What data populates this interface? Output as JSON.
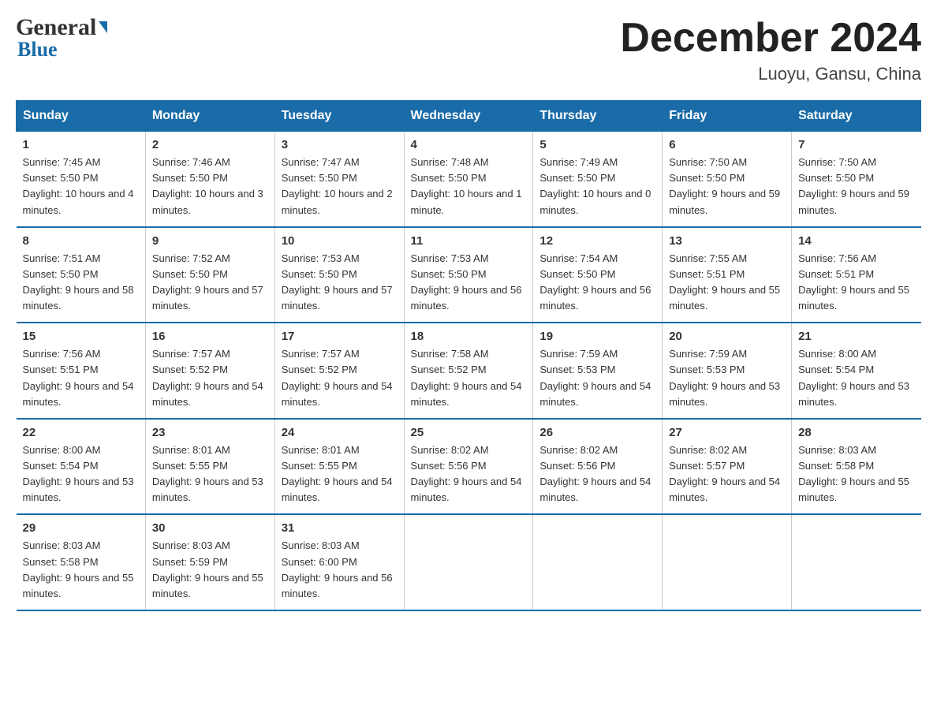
{
  "header": {
    "logo_general": "General",
    "logo_blue": "Blue",
    "month_year": "December 2024",
    "location": "Luoyu, Gansu, China"
  },
  "days_of_week": [
    "Sunday",
    "Monday",
    "Tuesday",
    "Wednesday",
    "Thursday",
    "Friday",
    "Saturday"
  ],
  "weeks": [
    [
      {
        "day": "1",
        "sunrise": "7:45 AM",
        "sunset": "5:50 PM",
        "daylight": "10 hours and 4 minutes."
      },
      {
        "day": "2",
        "sunrise": "7:46 AM",
        "sunset": "5:50 PM",
        "daylight": "10 hours and 3 minutes."
      },
      {
        "day": "3",
        "sunrise": "7:47 AM",
        "sunset": "5:50 PM",
        "daylight": "10 hours and 2 minutes."
      },
      {
        "day": "4",
        "sunrise": "7:48 AM",
        "sunset": "5:50 PM",
        "daylight": "10 hours and 1 minute."
      },
      {
        "day": "5",
        "sunrise": "7:49 AM",
        "sunset": "5:50 PM",
        "daylight": "10 hours and 0 minutes."
      },
      {
        "day": "6",
        "sunrise": "7:50 AM",
        "sunset": "5:50 PM",
        "daylight": "9 hours and 59 minutes."
      },
      {
        "day": "7",
        "sunrise": "7:50 AM",
        "sunset": "5:50 PM",
        "daylight": "9 hours and 59 minutes."
      }
    ],
    [
      {
        "day": "8",
        "sunrise": "7:51 AM",
        "sunset": "5:50 PM",
        "daylight": "9 hours and 58 minutes."
      },
      {
        "day": "9",
        "sunrise": "7:52 AM",
        "sunset": "5:50 PM",
        "daylight": "9 hours and 57 minutes."
      },
      {
        "day": "10",
        "sunrise": "7:53 AM",
        "sunset": "5:50 PM",
        "daylight": "9 hours and 57 minutes."
      },
      {
        "day": "11",
        "sunrise": "7:53 AM",
        "sunset": "5:50 PM",
        "daylight": "9 hours and 56 minutes."
      },
      {
        "day": "12",
        "sunrise": "7:54 AM",
        "sunset": "5:50 PM",
        "daylight": "9 hours and 56 minutes."
      },
      {
        "day": "13",
        "sunrise": "7:55 AM",
        "sunset": "5:51 PM",
        "daylight": "9 hours and 55 minutes."
      },
      {
        "day": "14",
        "sunrise": "7:56 AM",
        "sunset": "5:51 PM",
        "daylight": "9 hours and 55 minutes."
      }
    ],
    [
      {
        "day": "15",
        "sunrise": "7:56 AM",
        "sunset": "5:51 PM",
        "daylight": "9 hours and 54 minutes."
      },
      {
        "day": "16",
        "sunrise": "7:57 AM",
        "sunset": "5:52 PM",
        "daylight": "9 hours and 54 minutes."
      },
      {
        "day": "17",
        "sunrise": "7:57 AM",
        "sunset": "5:52 PM",
        "daylight": "9 hours and 54 minutes."
      },
      {
        "day": "18",
        "sunrise": "7:58 AM",
        "sunset": "5:52 PM",
        "daylight": "9 hours and 54 minutes."
      },
      {
        "day": "19",
        "sunrise": "7:59 AM",
        "sunset": "5:53 PM",
        "daylight": "9 hours and 54 minutes."
      },
      {
        "day": "20",
        "sunrise": "7:59 AM",
        "sunset": "5:53 PM",
        "daylight": "9 hours and 53 minutes."
      },
      {
        "day": "21",
        "sunrise": "8:00 AM",
        "sunset": "5:54 PM",
        "daylight": "9 hours and 53 minutes."
      }
    ],
    [
      {
        "day": "22",
        "sunrise": "8:00 AM",
        "sunset": "5:54 PM",
        "daylight": "9 hours and 53 minutes."
      },
      {
        "day": "23",
        "sunrise": "8:01 AM",
        "sunset": "5:55 PM",
        "daylight": "9 hours and 53 minutes."
      },
      {
        "day": "24",
        "sunrise": "8:01 AM",
        "sunset": "5:55 PM",
        "daylight": "9 hours and 54 minutes."
      },
      {
        "day": "25",
        "sunrise": "8:02 AM",
        "sunset": "5:56 PM",
        "daylight": "9 hours and 54 minutes."
      },
      {
        "day": "26",
        "sunrise": "8:02 AM",
        "sunset": "5:56 PM",
        "daylight": "9 hours and 54 minutes."
      },
      {
        "day": "27",
        "sunrise": "8:02 AM",
        "sunset": "5:57 PM",
        "daylight": "9 hours and 54 minutes."
      },
      {
        "day": "28",
        "sunrise": "8:03 AM",
        "sunset": "5:58 PM",
        "daylight": "9 hours and 55 minutes."
      }
    ],
    [
      {
        "day": "29",
        "sunrise": "8:03 AM",
        "sunset": "5:58 PM",
        "daylight": "9 hours and 55 minutes."
      },
      {
        "day": "30",
        "sunrise": "8:03 AM",
        "sunset": "5:59 PM",
        "daylight": "9 hours and 55 minutes."
      },
      {
        "day": "31",
        "sunrise": "8:03 AM",
        "sunset": "6:00 PM",
        "daylight": "9 hours and 56 minutes."
      },
      {
        "day": "",
        "sunrise": "",
        "sunset": "",
        "daylight": ""
      },
      {
        "day": "",
        "sunrise": "",
        "sunset": "",
        "daylight": ""
      },
      {
        "day": "",
        "sunrise": "",
        "sunset": "",
        "daylight": ""
      },
      {
        "day": "",
        "sunrise": "",
        "sunset": "",
        "daylight": ""
      }
    ]
  ]
}
